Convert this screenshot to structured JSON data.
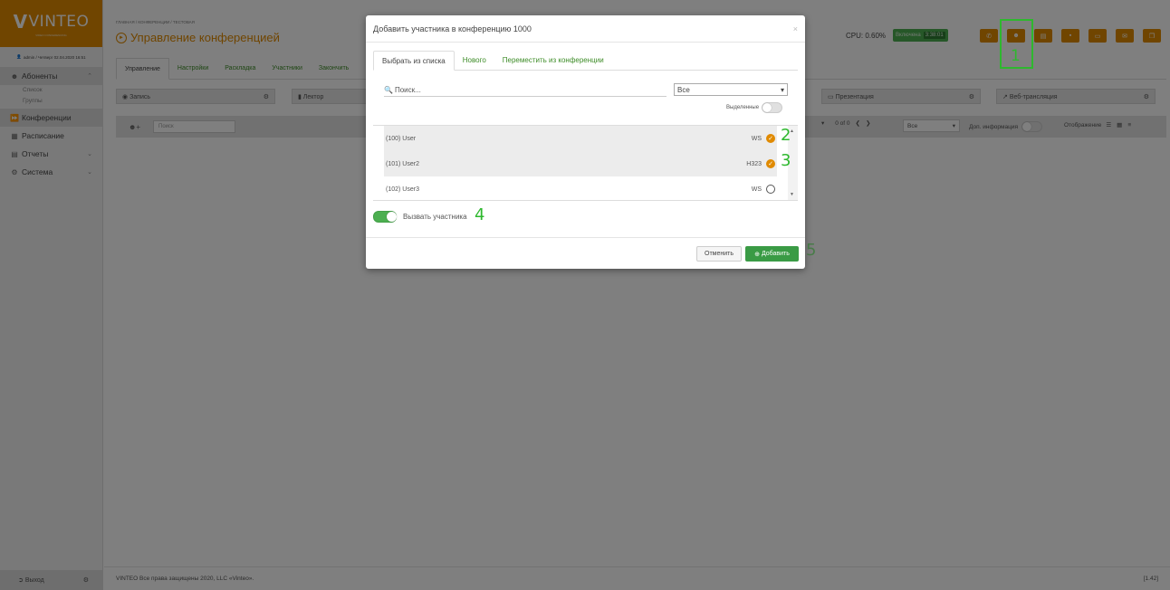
{
  "sidebar": {
    "logo_text": "VINTEO",
    "logo_tagline": "VIDEO CONFERENCING",
    "user_line": "admin / Четверг 02.04.2020 16:51",
    "items": [
      {
        "label": "Абоненты",
        "icon": "users-icon"
      },
      {
        "label": "Конференции",
        "icon": "forward-icon"
      },
      {
        "label": "Расписание",
        "icon": "calendar-icon"
      },
      {
        "label": "Отчеты",
        "icon": "book-icon"
      },
      {
        "label": "Система",
        "icon": "gears-icon"
      }
    ],
    "sub_items": [
      "Список",
      "Группы"
    ],
    "logout": "Выход"
  },
  "header": {
    "breadcrumb": "ГЛАВНАЯ / КОНФЕРЕНЦИИ / ТЕСТОВАЯ",
    "title": "Управление конференцией",
    "cpu": "CPU: 0.60%",
    "status": "Включена",
    "uptime": "3:38:01"
  },
  "tabs": [
    "Управление",
    "Настройки",
    "Раскладка",
    "Участники",
    "Закончить"
  ],
  "panels": {
    "record": "Запись",
    "lecturer": "Лектор",
    "presentation": "Презентация",
    "webcast": "Веб-трансляция"
  },
  "strip": {
    "search_placeholder": "Поиск",
    "pager": "0 of 0",
    "filter": "Все",
    "more_info": "Доп. информация",
    "display": "Отображение"
  },
  "footer": {
    "copyright": "VINTEO  Все права защищены 2020, LLC «Vinteo».",
    "version": "[1.42]"
  },
  "modal": {
    "title": "Добавить участника в конференцию 1000",
    "close": "×",
    "tabs": [
      "Выбрать из списка",
      "Нового",
      "Переместить из конференции"
    ],
    "search_placeholder": "Поиск...",
    "filter_value": "Все",
    "selected_only": "Выделенные",
    "rows": [
      {
        "name": "(100) User",
        "proto": "WS",
        "checked": true
      },
      {
        "name": "(101) User2",
        "proto": "H323",
        "checked": true
      },
      {
        "name": "(102) User3",
        "proto": "WS",
        "checked": false
      }
    ],
    "call_label": "Вызвать участника",
    "cancel": "Отменить",
    "add": "Добавить"
  },
  "annotations": [
    "1",
    "2",
    "3",
    "4",
    "5"
  ],
  "colors": {
    "accent": "#e08a00",
    "green": "#3a9b45",
    "annotation": "#2eb82e"
  }
}
